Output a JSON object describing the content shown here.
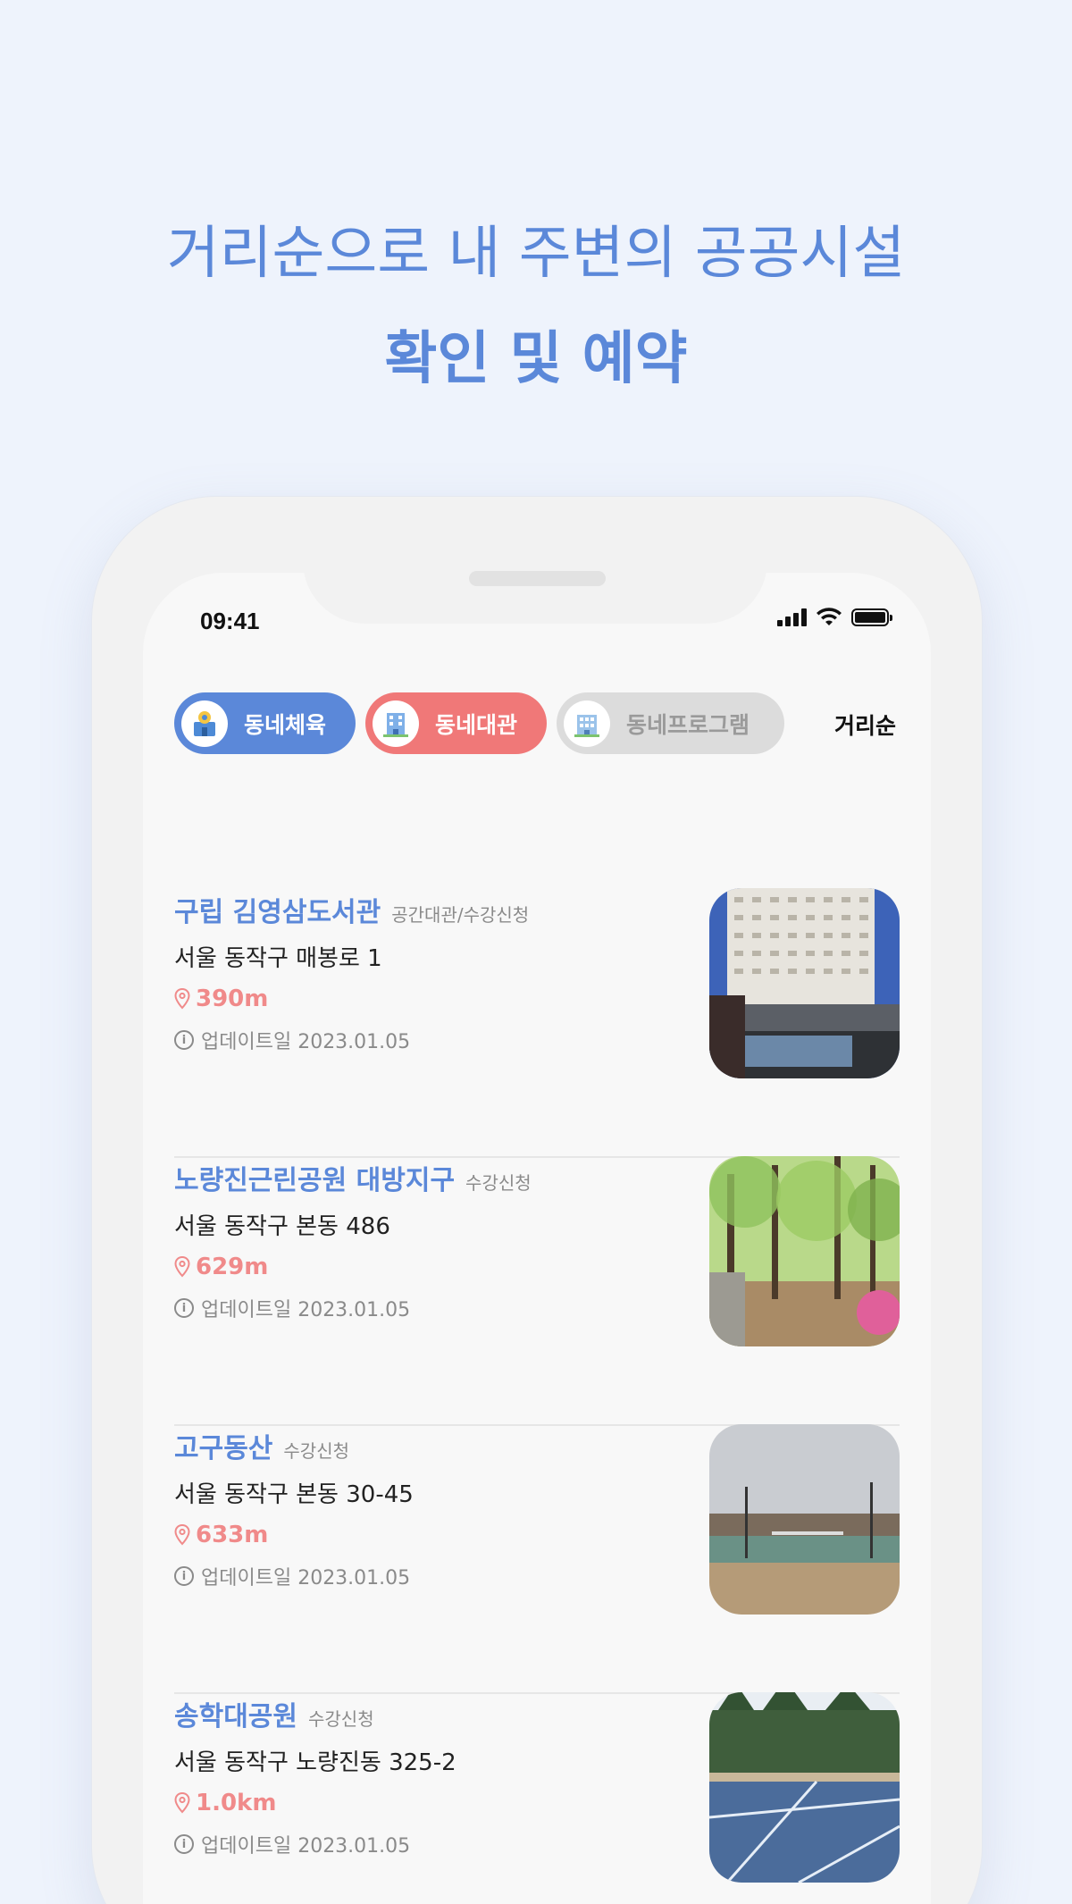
{
  "headline": {
    "line1": "거리순으로 내 주변의 공공시설",
    "line2": "확인 및 예약"
  },
  "status_bar": {
    "time": "09:41",
    "icons": [
      "signal-icon",
      "wifi-icon",
      "battery-icon"
    ]
  },
  "tabs": [
    {
      "label": "동네체육",
      "icon": "sports-facility-icon",
      "color": "#5b88d9"
    },
    {
      "label": "동네대관",
      "icon": "building-rental-icon",
      "color": "#f07878"
    },
    {
      "label": "동네프로그램",
      "icon": "program-building-icon",
      "color": "#dcdcdc"
    }
  ],
  "sort_label": "거리순",
  "facilities": [
    {
      "name": "구립 김영삼도서관",
      "tag": "공간대관/수강신청",
      "address": "서울 동작구 매봉로 1",
      "distance": "390m",
      "updated": "업데이트일 2023.01.05"
    },
    {
      "name": "노량진근린공원 대방지구",
      "tag": "수강신청",
      "address": "서울 동작구 본동 486",
      "distance": "629m",
      "updated": "업데이트일 2023.01.05"
    },
    {
      "name": "고구동산",
      "tag": "수강신청",
      "address": "서울 동작구 본동 30-45",
      "distance": "633m",
      "updated": "업데이트일 2023.01.05"
    },
    {
      "name": "송학대공원",
      "tag": "수강신청",
      "address": "서울 동작구 노량진동 325-2",
      "distance": "1.0km",
      "updated": "업데이트일 2023.01.05"
    }
  ],
  "colors": {
    "accent_blue": "#5b88d9",
    "accent_red": "#f07878",
    "distance_pink": "#f08a8a",
    "background": "#eef3fc"
  }
}
